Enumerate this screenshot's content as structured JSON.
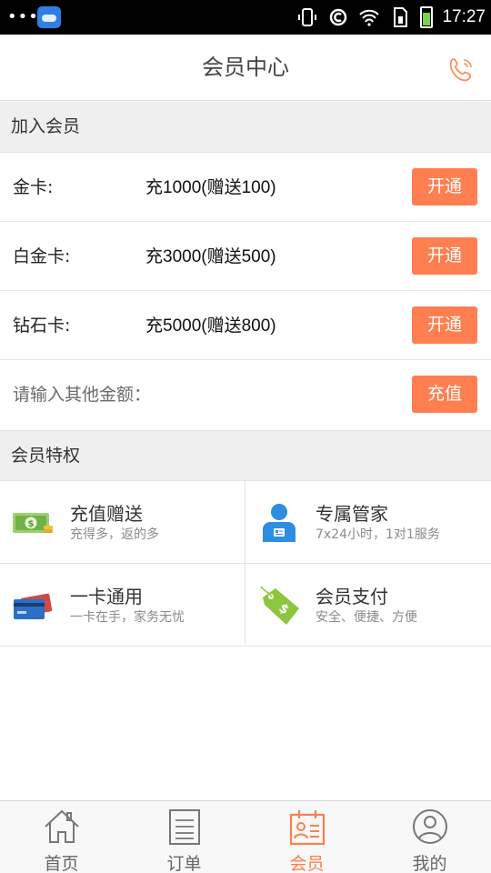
{
  "status_bar": {
    "dots": "•••",
    "time": "17:27",
    "battery_color": "#7ad14b"
  },
  "header": {
    "title": "会员中心",
    "phone_icon": "phone-icon"
  },
  "join_section": {
    "title": "加入会员",
    "rows": [
      {
        "label": "金卡:",
        "prefix": "充",
        "amount": "1000(赠送100)",
        "button": "开通"
      },
      {
        "label": "白金卡:",
        "prefix": "充",
        "amount": "3000(赠送500)",
        "button": "开通"
      },
      {
        "label": "钻石卡:",
        "prefix": "充",
        "amount": "5000(赠送800)",
        "button": "开通"
      }
    ],
    "custom": {
      "placeholder": "请输入其他金额：",
      "button": "充值"
    }
  },
  "privileges_section": {
    "title": "会员特权",
    "items": [
      {
        "title": "充值赠送",
        "subtitle": "充得多，返的多",
        "icon": "money-icon"
      },
      {
        "title": "专属管家",
        "subtitle": "7x24小时，1对1服务",
        "icon": "butler-icon"
      },
      {
        "title": "一卡通用",
        "subtitle": "一卡在手，家务无忧",
        "icon": "card-icon"
      },
      {
        "title": "会员支付",
        "subtitle": "安全、便捷、方便",
        "icon": "price-tag-icon"
      }
    ]
  },
  "tab_bar": {
    "tabs": [
      {
        "label": "首页",
        "icon": "home-icon"
      },
      {
        "label": "订单",
        "icon": "order-icon"
      },
      {
        "label": "会员",
        "icon": "member-icon",
        "active": true
      },
      {
        "label": "我的",
        "icon": "profile-icon"
      }
    ]
  },
  "colors": {
    "accent": "#ff7f50",
    "section_bg": "#efefef",
    "inactive_tab": "#666666"
  }
}
